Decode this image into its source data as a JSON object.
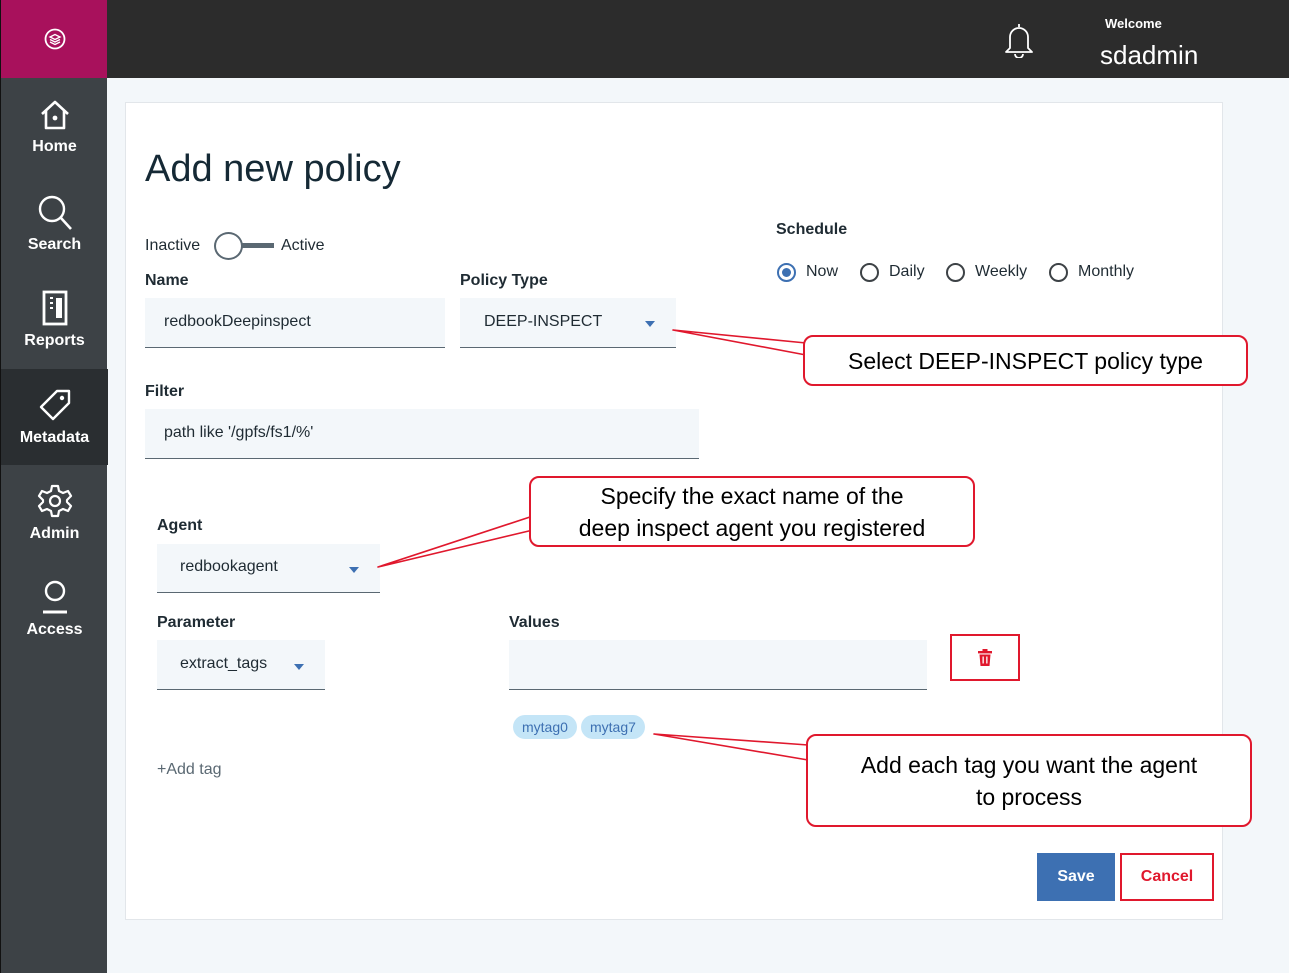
{
  "header": {
    "welcome_label": "Welcome",
    "username": "sdadmin"
  },
  "nav": [
    {
      "label": "Home",
      "icon": "home-icon"
    },
    {
      "label": "Search",
      "icon": "search-icon"
    },
    {
      "label": "Reports",
      "icon": "reports-icon"
    },
    {
      "label": "Metadata",
      "icon": "tag-icon",
      "active": true
    },
    {
      "label": "Admin",
      "icon": "gear-icon"
    },
    {
      "label": "Access",
      "icon": "user-icon"
    }
  ],
  "form": {
    "title": "Add new policy",
    "toggle": {
      "off_label": "Inactive",
      "on_label": "Active",
      "state": "inactive"
    },
    "name": {
      "label": "Name",
      "value": "redbookDeepinspect"
    },
    "policy_type": {
      "label": "Policy Type",
      "value": "DEEP-INSPECT"
    },
    "schedule": {
      "label": "Schedule",
      "options": [
        "Now",
        "Daily",
        "Weekly",
        "Monthly"
      ],
      "selected": "Now"
    },
    "filter": {
      "label": "Filter",
      "value": "path like '/gpfs/fs1/%'"
    },
    "agent": {
      "label": "Agent",
      "value": "redbookagent"
    },
    "parameter": {
      "label": "Parameter",
      "value": "extract_tags"
    },
    "values": {
      "label": "Values",
      "value": "",
      "tags": [
        "mytag0",
        "mytag7"
      ]
    },
    "add_tag_label": "+Add tag",
    "save_label": "Save",
    "cancel_label": "Cancel"
  },
  "callouts": {
    "policy_type": "Select DEEP-INSPECT policy type",
    "agent_line1": "Specify the exact name of the",
    "agent_line2": "deep inspect agent you registered",
    "tags_line1": "Add each tag you want the agent",
    "tags_line2": "to process"
  },
  "colors": {
    "brand": "#a8115c",
    "accent": "#3d70b2",
    "annotation": "#e0182d",
    "rail": "#3d4246",
    "topbar": "#2c2c2c"
  }
}
